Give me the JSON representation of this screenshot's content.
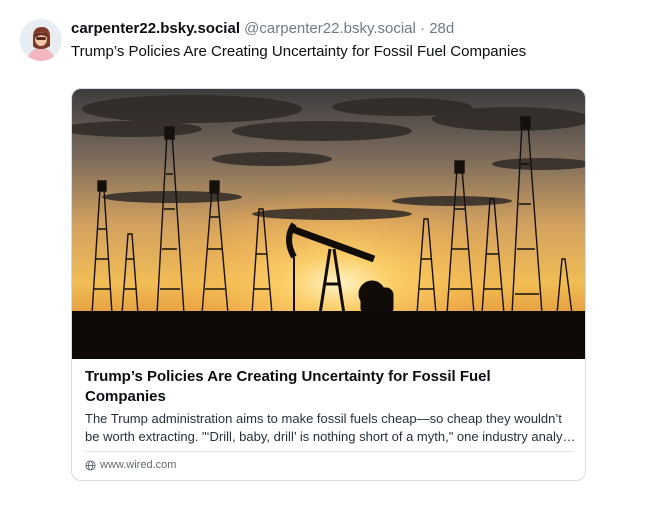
{
  "post": {
    "author_name": "carpenter22.bsky.social",
    "handle": "@carpenter22.bsky.social",
    "separator": "·",
    "time_ago": "28d",
    "text": "Trump’s Policies Are Creating Uncertainty for Fossil Fuel Companies"
  },
  "card": {
    "image_icon": "oil-field-sunset-image",
    "title": "Trump’s Policies Are Creating Uncertainty for Fossil Fuel Companies",
    "description": "The Trump administration aims to make fossil fuels cheap—so cheap they wouldn’t be worth extracting. \"‘Drill, baby, drill’ is nothing short of a myth,\" one industry analyst says.",
    "link_icon": "globe-icon",
    "domain": "www.wired.com"
  },
  "colors": {
    "text_primary": "#0b0f14",
    "text_secondary": "#6f7b87",
    "border": "#d4dbe2",
    "sky_top": "#3a3f46",
    "sky_glow": "#f6c35a"
  }
}
